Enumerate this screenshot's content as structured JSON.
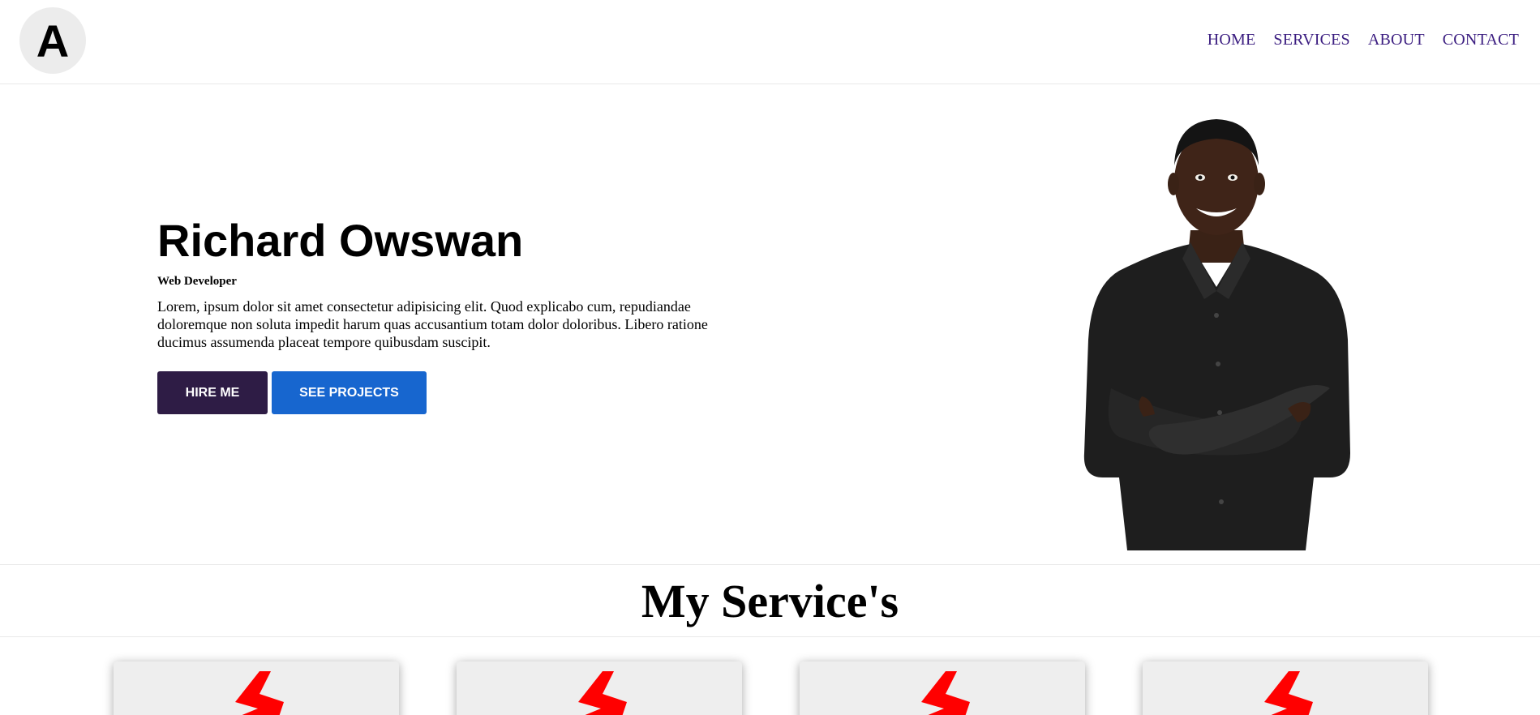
{
  "header": {
    "logo_letter": "A",
    "nav": [
      "HOME",
      "SERVICES",
      "ABOUT",
      "CONTACT"
    ]
  },
  "hero": {
    "name": "Richard Owswan",
    "role": "Web Developer",
    "description": "Lorem, ipsum dolor sit amet consectetur adipisicing elit. Quod explicabo cum, repudiandae doloremque non soluta impedit harum quas accusantium totam dolor doloribus. Libero ratione ducimus assumenda placeat tempore quibusdam suscipit.",
    "hire_label": "HIRE ME",
    "projects_label": "SEE PROJECTS",
    "portrait_icon": "person-photo"
  },
  "services": {
    "title": "My Service's",
    "cards": [
      {
        "icon": "lightning-bolt-icon"
      },
      {
        "icon": "lightning-bolt-icon"
      },
      {
        "icon": "lightning-bolt-icon"
      },
      {
        "icon": "lightning-bolt-icon"
      }
    ]
  },
  "colors": {
    "nav_link": "#3b1d80",
    "hire_button": "#2e1c45",
    "projects_button": "#1766cf",
    "bolt": "#ff0000"
  }
}
